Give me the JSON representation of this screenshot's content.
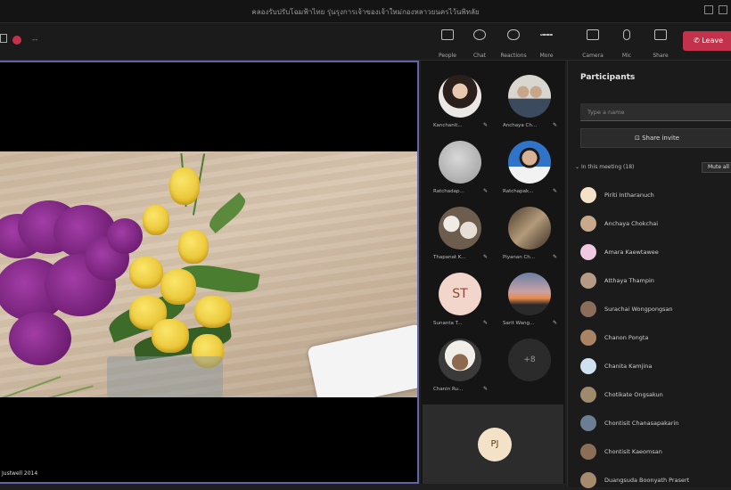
{
  "window": {
    "title": "คลองรับปรับโฉมฟ้าไทย รุ่นรุงการเจ้าของเจ้าใหม่กองหลาวยนครไว้นพิทลัย"
  },
  "toolbar": {
    "timer": "--",
    "buttons": [
      {
        "label": "People",
        "icon": "people-icon"
      },
      {
        "label": "Chat",
        "icon": "chat-icon"
      },
      {
        "label": "Reactions",
        "icon": "reactions-icon"
      },
      {
        "label": "More",
        "icon": "more-icon"
      },
      {
        "label": "Camera",
        "icon": "camera-icon"
      },
      {
        "label": "Mic",
        "icon": "mic-icon"
      },
      {
        "label": "Share",
        "icon": "share-icon"
      }
    ],
    "leave_label": "Leave"
  },
  "stage": {
    "presenter_name": "Justwell 2014"
  },
  "gallery": {
    "tiles": [
      {
        "name": "Kanchanit...",
        "avatar": "photo"
      },
      {
        "name": "Anchaya Ch...",
        "avatar": "photo"
      },
      {
        "name": "Ratchadap...",
        "avatar": "photo"
      },
      {
        "name": "Ratchapak...",
        "avatar": "photo"
      },
      {
        "name": "Thapanat K...",
        "avatar": "photo"
      },
      {
        "name": "Piyanan Ch...",
        "avatar": "photo"
      },
      {
        "name": "Sunanta T...",
        "avatar": "initials",
        "initials": "ST"
      },
      {
        "name": "Sarit Wang...",
        "avatar": "photo"
      },
      {
        "name": "Chanin Ru...",
        "avatar": "photo"
      },
      {
        "name": "",
        "avatar": "more",
        "initials": "+8"
      }
    ],
    "self_initials": "PJ"
  },
  "participants": {
    "heading": "Participants",
    "search_placeholder": "Type a name",
    "share_invite_label": "Share invite",
    "section_label": "In this meeting (18)",
    "mute_all_label": "Mute all",
    "list": [
      {
        "name": "Piriti Intharanuch",
        "color": "#f3e2c8"
      },
      {
        "name": "Anchaya Chokchai",
        "color": "#c9a98b"
      },
      {
        "name": "Amara Kaewtawee",
        "color": "#f0c8e0"
      },
      {
        "name": "Atthaya Thampin",
        "color": "#b59a86"
      },
      {
        "name": "Surachai Wongpongsan",
        "color": "#8a6d5a"
      },
      {
        "name": "Chanon Pongta",
        "color": "#a88464"
      },
      {
        "name": "Chanita Kamjina",
        "color": "#cfe0ef"
      },
      {
        "name": "Chotikate Ongsakun",
        "color": "#9e8a6c"
      },
      {
        "name": "Chontisit Chanasapakarin",
        "color": "#6c7e94"
      },
      {
        "name": "Chontisit Kaeomsan",
        "color": "#8c6e58"
      },
      {
        "name": "Duangsuda Boonyath Prasert",
        "color": "#a58a70"
      }
    ]
  }
}
